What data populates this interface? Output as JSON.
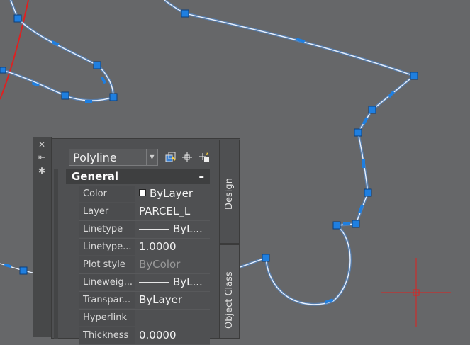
{
  "palette": {
    "object_type": "Polyline",
    "section_title": "General",
    "collapse_symbol": "–",
    "properties": [
      {
        "name": "Color",
        "value": "ByLayer",
        "swatch": "#ffffff"
      },
      {
        "name": "Layer",
        "value": "PARCEL_L"
      },
      {
        "name": "Linetype",
        "value": "ByL...",
        "line_sample": true
      },
      {
        "name": "Linetype...",
        "value": "1.0000"
      },
      {
        "name": "Plot style",
        "value": "ByColor",
        "dim": true
      },
      {
        "name": "Lineweig...",
        "value": "ByL...",
        "line_sample": true
      },
      {
        "name": "Transpar...",
        "value": "ByLayer"
      },
      {
        "name": "Hyperlink",
        "value": ""
      },
      {
        "name": "Thickness",
        "value": "0.0000"
      }
    ],
    "tabs": {
      "design": "Design",
      "object_class": "Object Class"
    },
    "toolbar_icons": [
      "quick-select-icon",
      "select-objects-icon",
      "toggle-pickadd-icon"
    ],
    "strip_icons": [
      "close-icon",
      "auto-hide-icon",
      "palette-properties-icon"
    ]
  },
  "drawing": {
    "background": "#666769",
    "curve_color": "#cfe3ff",
    "curve_glow": "#4c8fe0",
    "grip_color": "#1f7fe0",
    "arc_color": "#e02020",
    "crosshair_color": "#e02020"
  }
}
